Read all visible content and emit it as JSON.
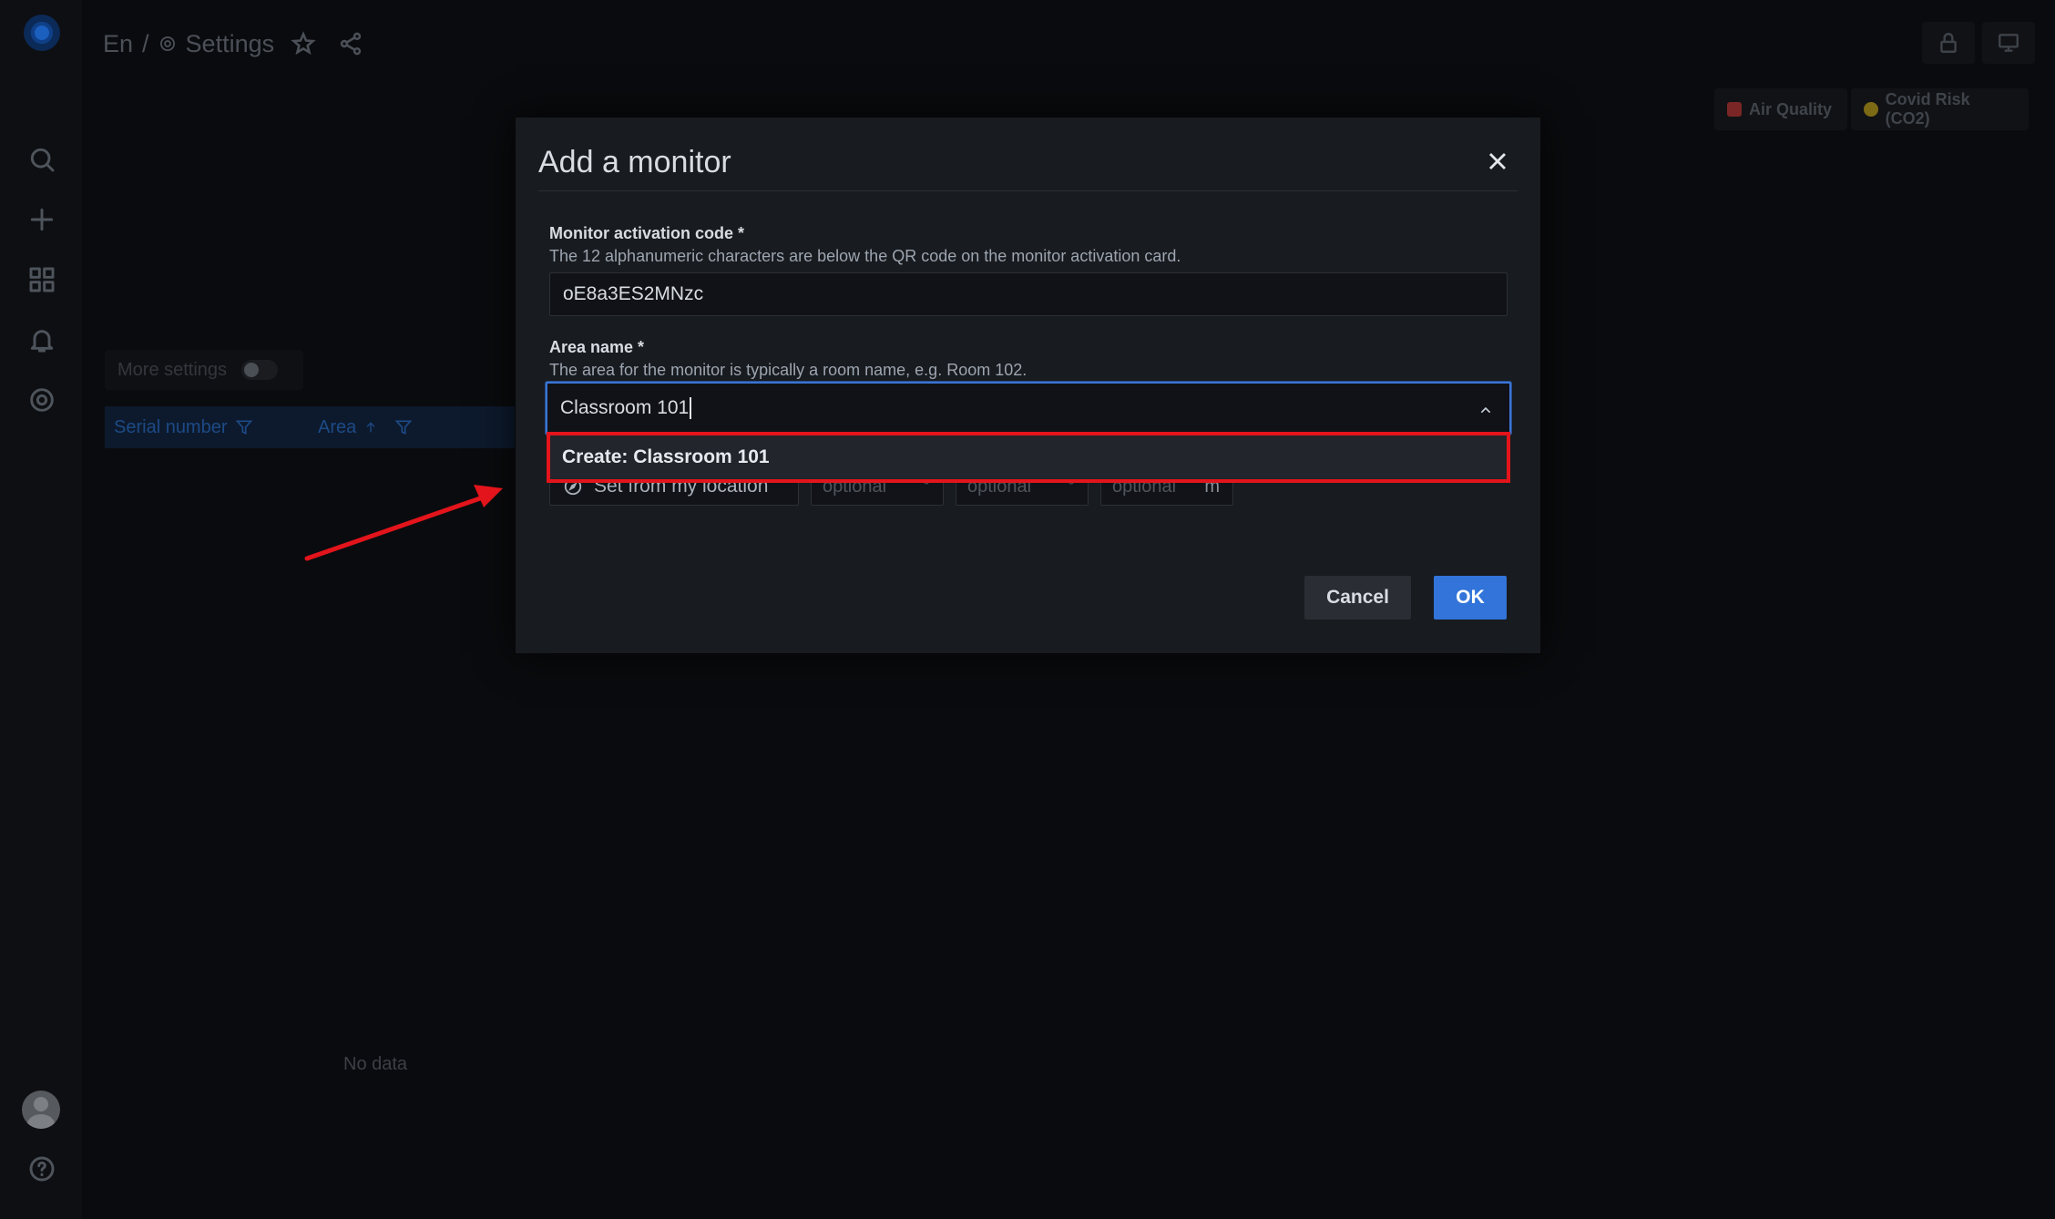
{
  "topbar": {
    "org": "En",
    "separator": "/",
    "page_title": "Settings"
  },
  "dashboard_links": [
    {
      "label": "Air Quality",
      "color": "#7a2626"
    },
    {
      "label": "Covid Risk (CO2)",
      "color": "#7d6a14"
    }
  ],
  "background": {
    "more_settings_label": "More settings",
    "columns": [
      "Serial number",
      "Area"
    ],
    "empty_text": "No data"
  },
  "modal": {
    "title": "Add a monitor",
    "activation": {
      "label": "Monitor activation code *",
      "description": "The 12 alphanumeric characters are below the QR code on the monitor activation card.",
      "value": "oE8a3ES2MNzc"
    },
    "area": {
      "label": "Area name *",
      "description": "The area for the monitor is typically a room name, e.g. Room 102.",
      "value": "Classroom 101"
    },
    "dropdown_option": "Create: Classroom 101",
    "location": {
      "button_label": "Set from my location",
      "fields": [
        {
          "placeholder": "optional",
          "unit": "°"
        },
        {
          "placeholder": "optional",
          "unit": "°"
        },
        {
          "placeholder": "optional",
          "unit": "m"
        }
      ]
    },
    "cancel_label": "Cancel",
    "ok_label": "OK"
  },
  "colors": {
    "accent": "#3274d9",
    "highlight": "#e3141b",
    "modal_bg": "#181b1f"
  }
}
